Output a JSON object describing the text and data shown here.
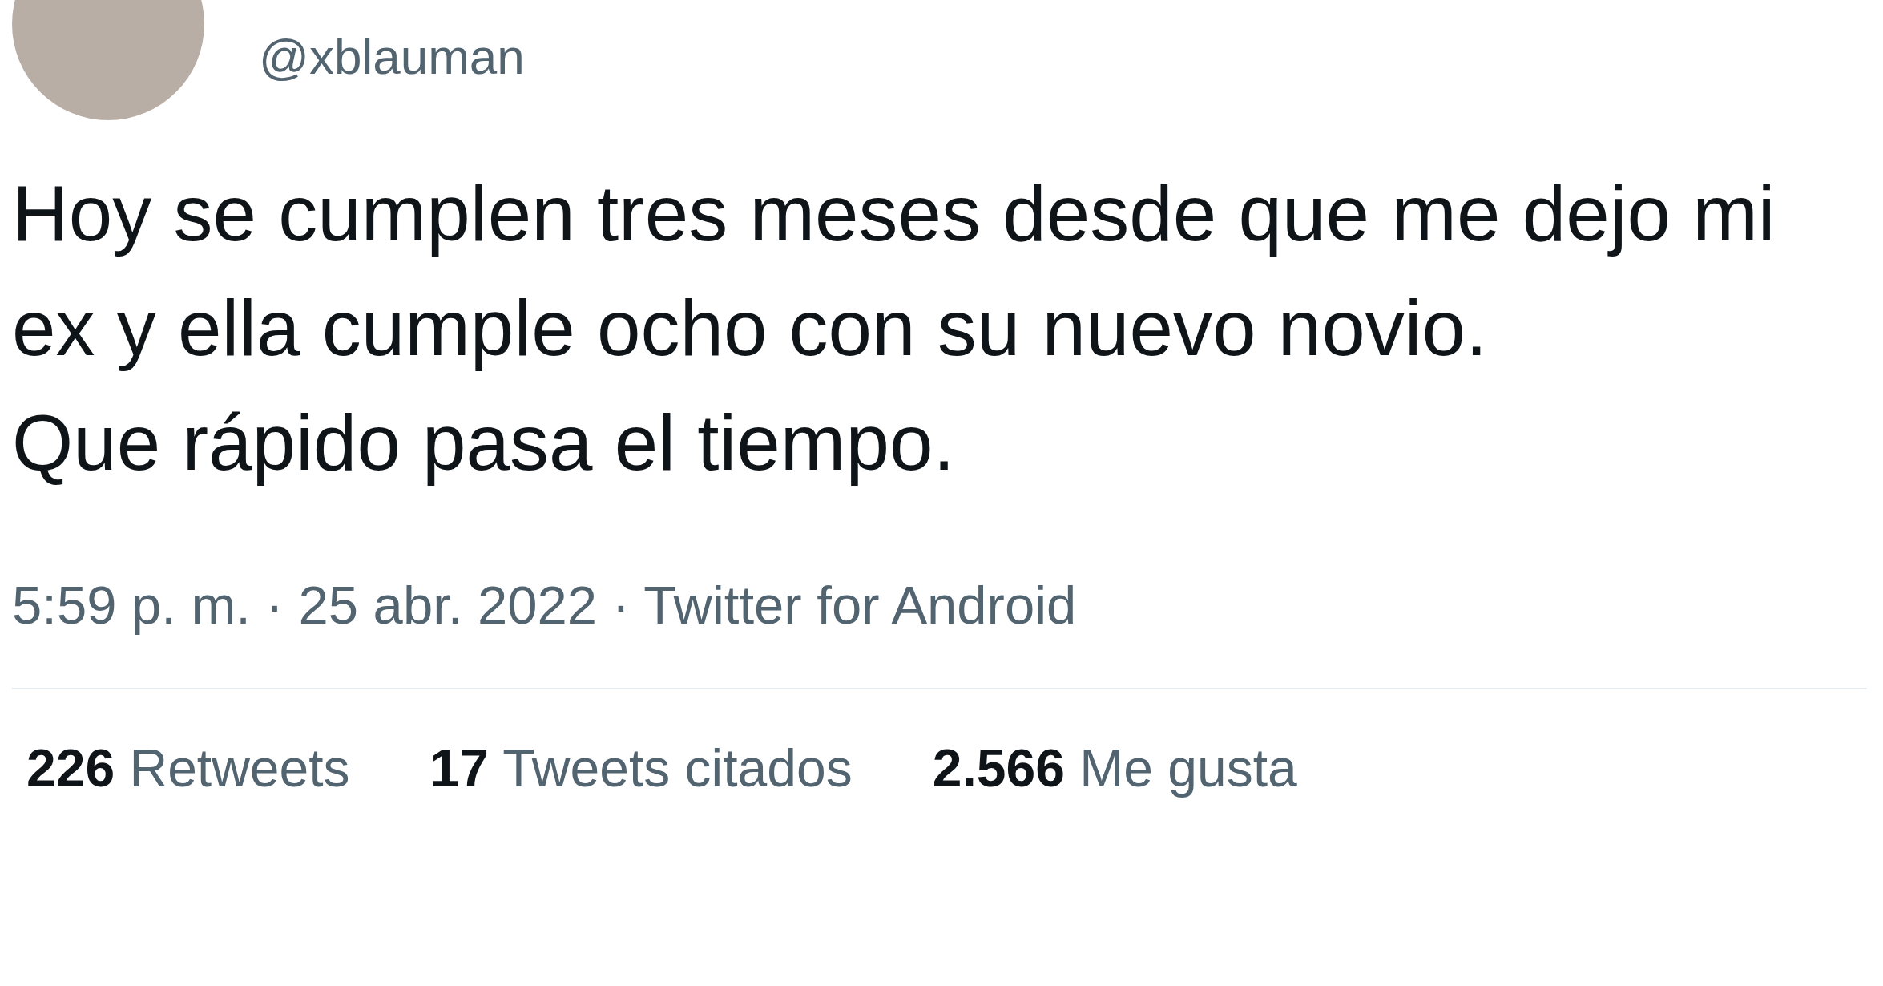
{
  "tweet": {
    "handle": "@xblauman",
    "text": "Hoy se cumplen tres meses desde que me dejo mi ex y ella cumple ocho con su nuevo novio.\nQue rápido pasa el tiempo.",
    "timestamp": "5:59 p. m. · 25 abr. 2022 · Twitter for Android",
    "stats": [
      {
        "count": "226",
        "label": "Retweets"
      },
      {
        "count": "17",
        "label": "Tweets citados"
      },
      {
        "count": "2.566",
        "label": "Me gusta"
      }
    ]
  }
}
